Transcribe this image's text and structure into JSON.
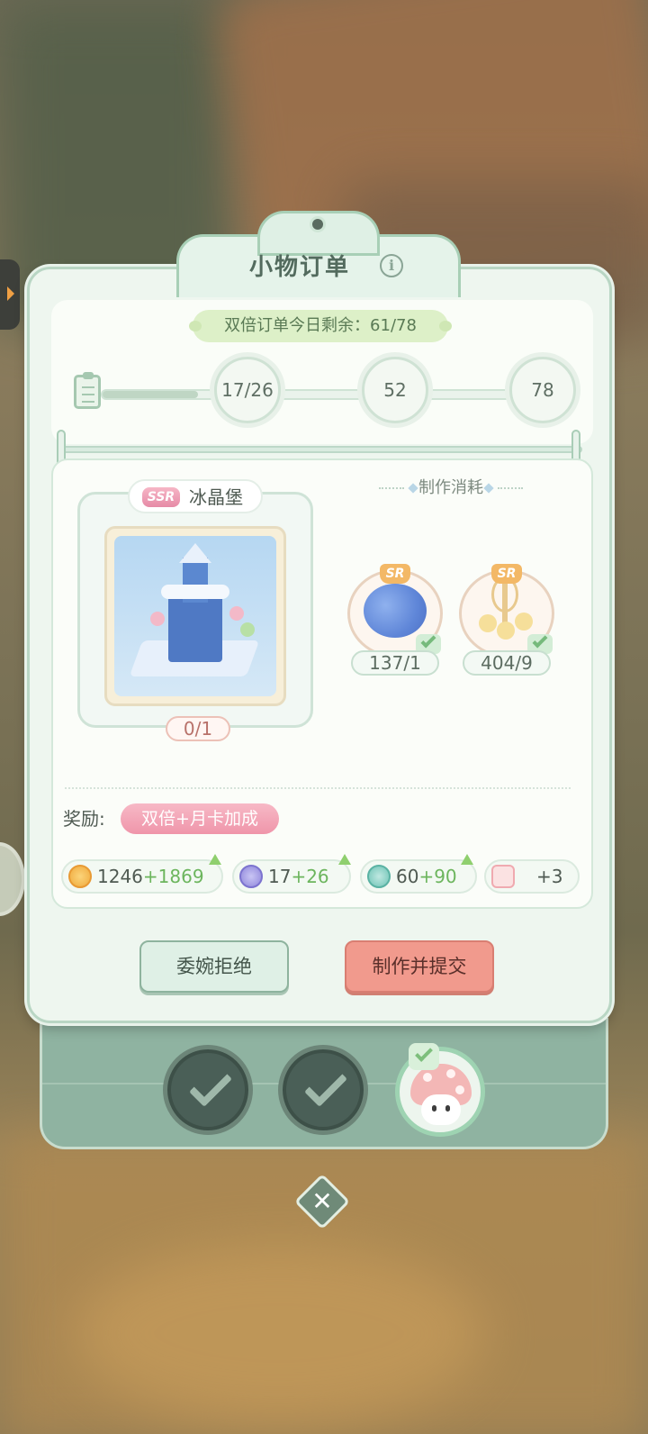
{
  "panel": {
    "title": "小物订单",
    "info_icon_glyph": "i",
    "double_orders": "双倍订单今日剩余：61/78"
  },
  "progress": {
    "fill_fraction": 0.21,
    "milestones": [
      "17/26",
      "52",
      "78"
    ]
  },
  "item": {
    "rarity": "SSR",
    "name": "冰晶堡",
    "count": "0/1"
  },
  "cost": {
    "title": "制作消耗",
    "materials": [
      {
        "rarity": "SR",
        "icon": "hydrangea-icon",
        "count": "137/1"
      },
      {
        "rarity": "SR",
        "icon": "daisy-icon",
        "count": "404/9"
      }
    ]
  },
  "reward": {
    "label": "奖励:",
    "bonus": "双倍+月卡加成",
    "items": [
      {
        "icon": "coin-icon",
        "base": "1246",
        "plus": "+1869"
      },
      {
        "icon": "gem-icon",
        "base": "17",
        "plus": "+26"
      },
      {
        "icon": "exp-icon",
        "base": "60",
        "plus": "+90"
      },
      {
        "icon": "gift-icon",
        "base": "+3",
        "plus": ""
      }
    ]
  },
  "buttons": {
    "reject": "委婉拒绝",
    "submit": "制作并提交",
    "close_glyph": "✕"
  },
  "colors": {
    "accent_green": "#6cb55d",
    "submit_red": "#f19a8d",
    "panel_bg": "#eef6ef"
  }
}
